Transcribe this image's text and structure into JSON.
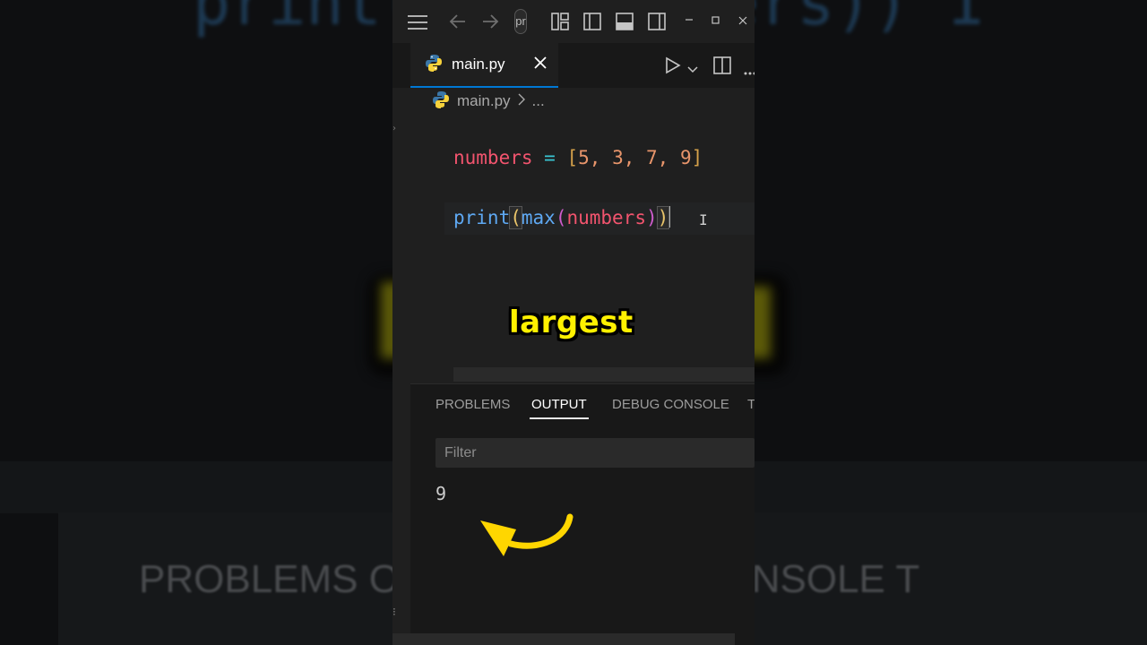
{
  "background": {
    "code_top": "print(max(numbers)) I",
    "tabs_blur": "PROBLEMS OUTPUT DEBUG CONSOLE T"
  },
  "titlebar": {
    "partial_title": "pr",
    "icons": [
      "menu-icon",
      "back-arrow-icon",
      "forward-arrow-icon",
      "layout-icon",
      "toggle-primary-sidebar-icon",
      "toggle-panel-icon",
      "toggle-secondary-sidebar-icon",
      "minimize-icon",
      "maximize-icon",
      "close-icon"
    ]
  },
  "tab": {
    "filename": "main.py"
  },
  "breadcrumb": {
    "file": "main.py",
    "more": "..."
  },
  "editor": {
    "line1": {
      "var": "numbers",
      "op": " = ",
      "open": "[",
      "n1": "5",
      "c1": ", ",
      "n2": "3",
      "c2": ", ",
      "n3": "7",
      "c3": ", ",
      "n4": "9",
      "close": "]"
    },
    "line2": {
      "fn": "print",
      "p1": "(",
      "fn2": "max",
      "p2": "(",
      "arg": "numbers",
      "p3": ")",
      "p4": ")"
    }
  },
  "caption": "largest",
  "panel": {
    "tabs": [
      "PROBLEMS",
      "OUTPUT",
      "DEBUG CONSOLE",
      "T"
    ],
    "active_tab": "OUTPUT",
    "filter_placeholder": "Filter",
    "output": "9"
  },
  "colors": {
    "accent": "#0078d4",
    "caption_yellow": "#fff100",
    "arrow_yellow": "#ffd600"
  }
}
